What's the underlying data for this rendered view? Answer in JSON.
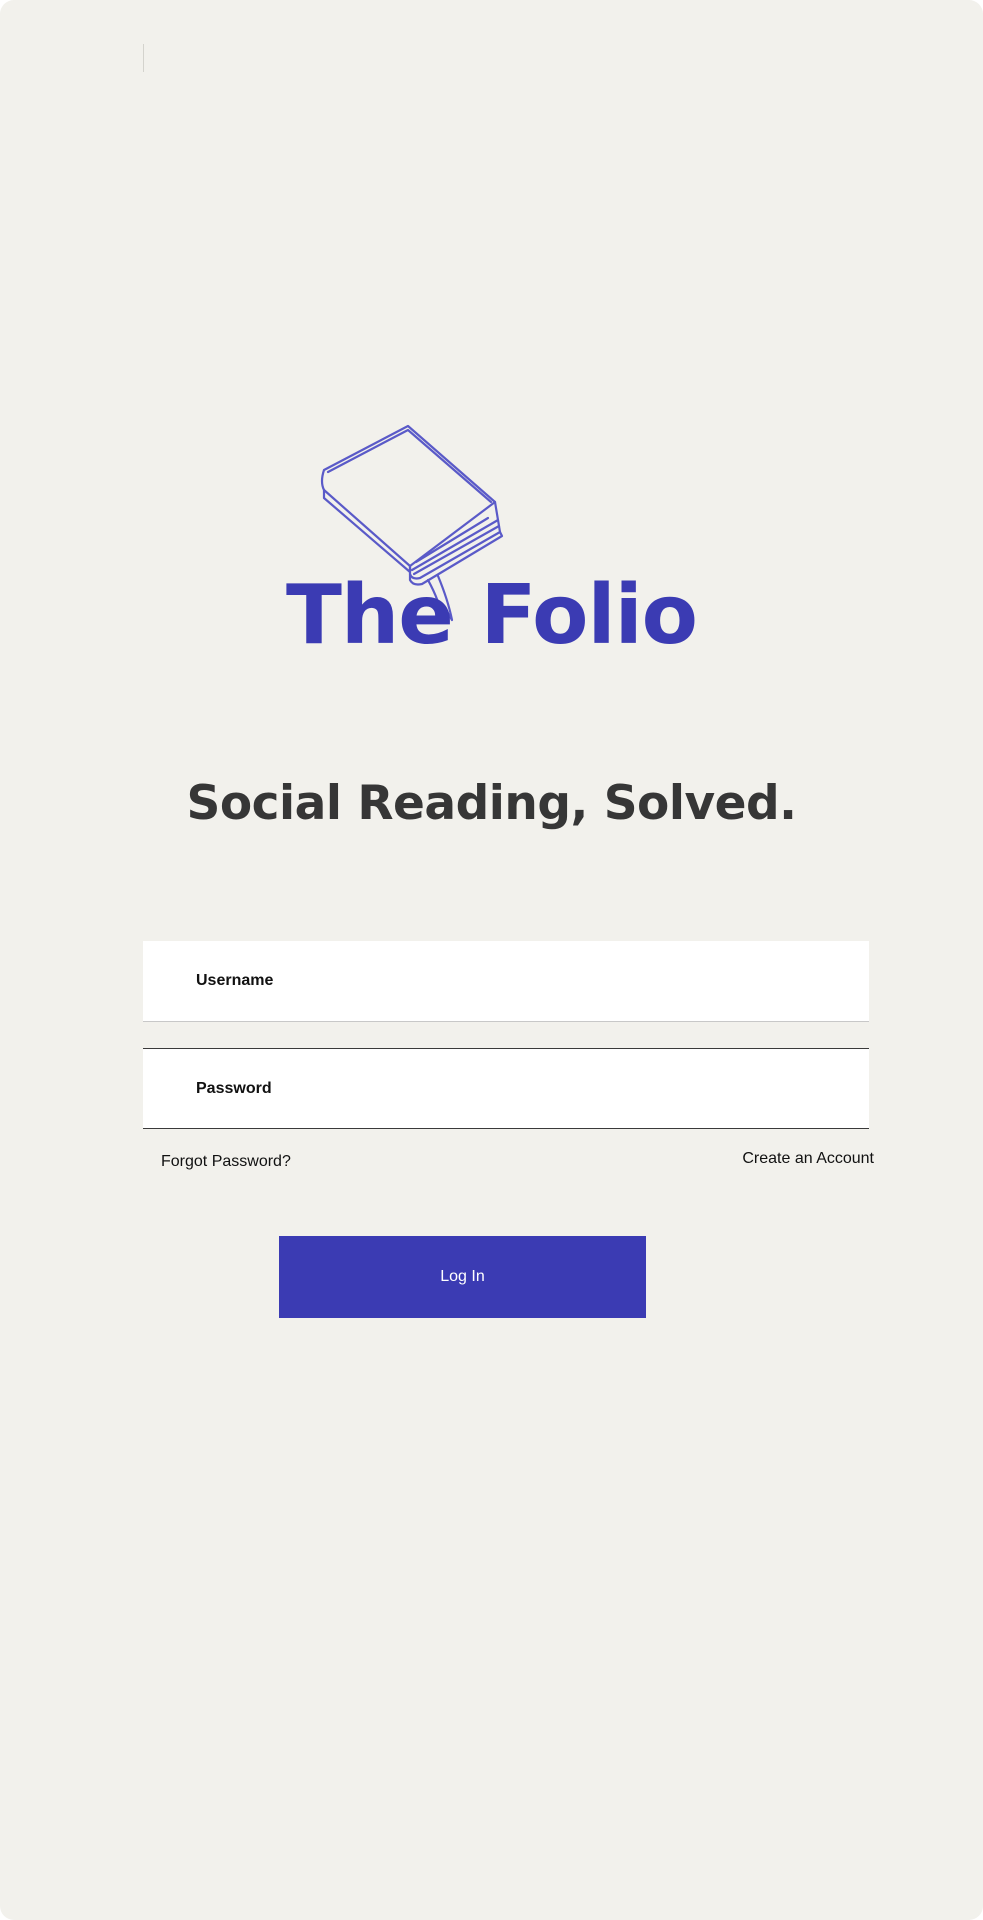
{
  "app": {
    "brand_name": "The Folio",
    "tagline": "Social Reading, Solved."
  },
  "logo": {
    "icon": "book-with-bookmark-icon"
  },
  "form": {
    "username_placeholder": "Username",
    "password_placeholder": "Password",
    "forgot_password_label": "Forgot Password?",
    "create_account_label": "Create an Account",
    "login_label": "Log In"
  },
  "colors": {
    "brand": "#3b3bb3",
    "background": "#f2f1ec",
    "tagline": "#363636",
    "field_background": "#ffffff"
  }
}
